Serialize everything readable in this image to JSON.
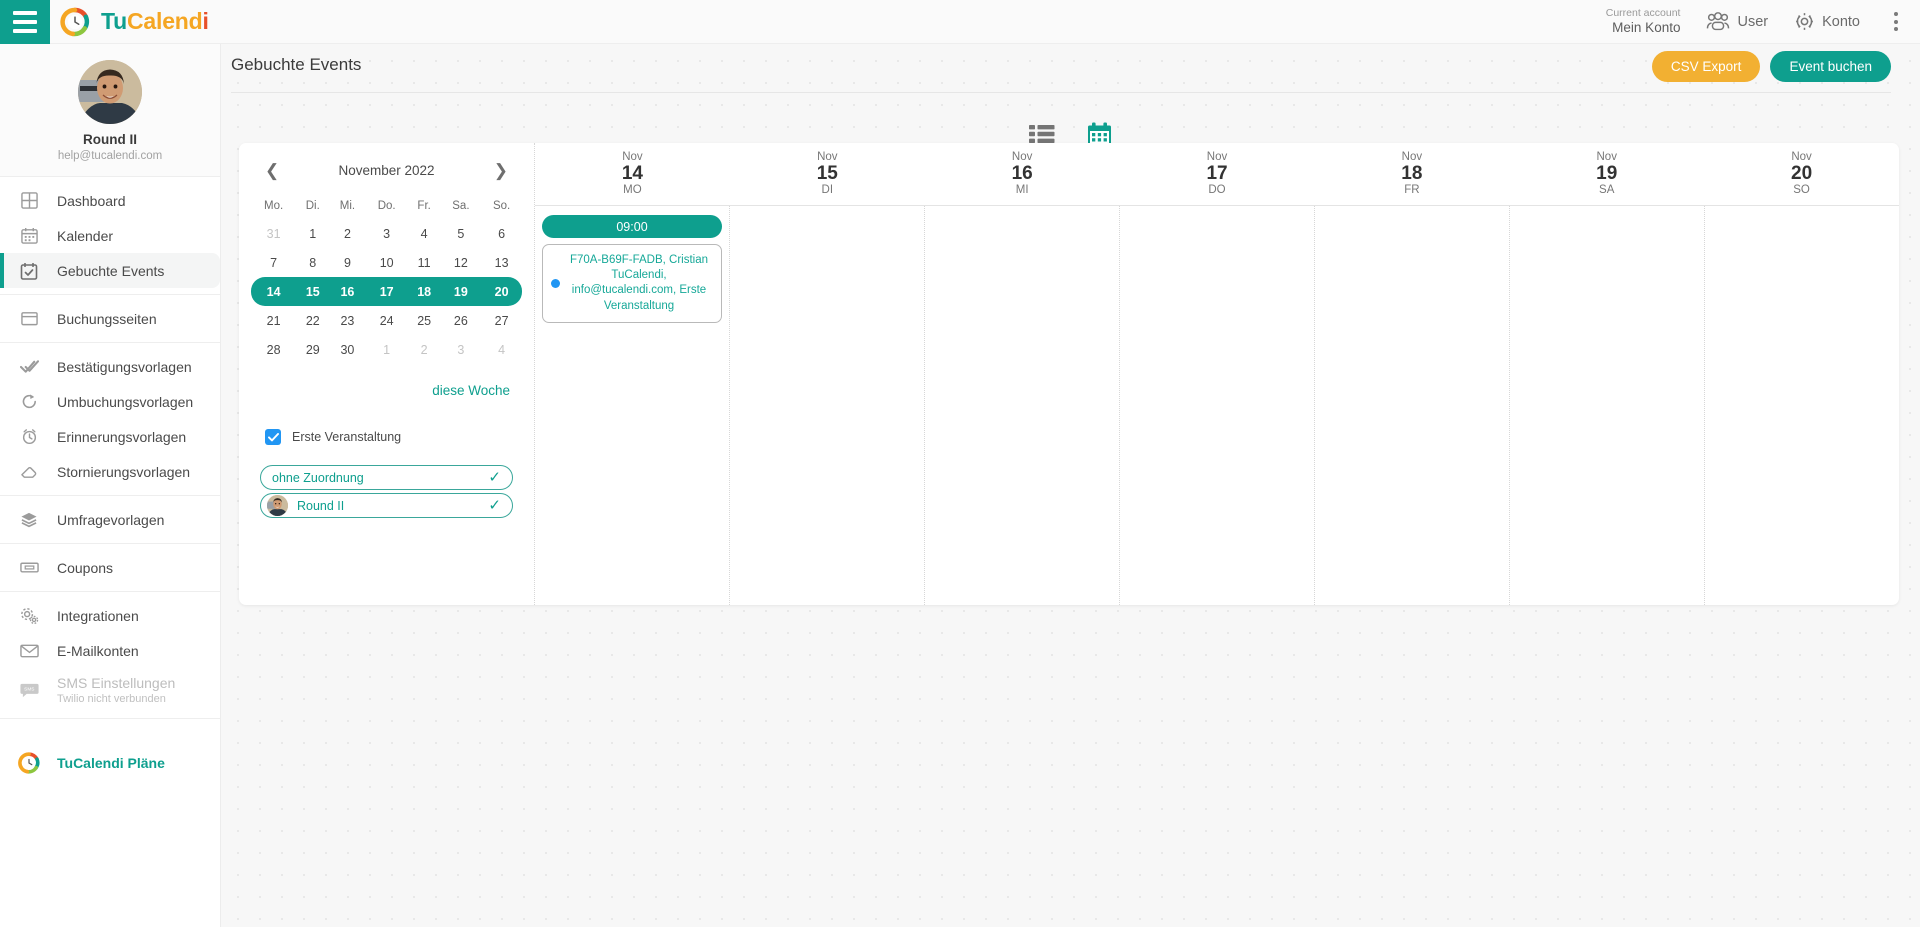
{
  "topbar": {
    "menu_icon": "hamburger-icon",
    "brand": {
      "part1": "Tu",
      "part2": "Calend",
      "part3": "i"
    },
    "account_label": "Current account",
    "account_value": "Mein Konto",
    "user_label": "User",
    "settings_label": "Konto",
    "overflow_icon": "kebab-menu-icon"
  },
  "sidebar": {
    "profile": {
      "name": "Round II",
      "email": "help@tucalendi.com"
    },
    "groups": [
      {
        "items": [
          {
            "label": "Dashboard",
            "icon": "dashboard-grid-icon",
            "active": false
          },
          {
            "label": "Kalender",
            "icon": "calendar-icon",
            "active": false
          },
          {
            "label": "Gebuchte Events",
            "icon": "calendar-check-icon",
            "active": true
          }
        ]
      },
      {
        "items": [
          {
            "label": "Buchungsseiten",
            "icon": "window-icon",
            "active": false
          }
        ]
      },
      {
        "items": [
          {
            "label": "Bestätigungsvorlagen",
            "icon": "double-check-icon",
            "active": false
          },
          {
            "label": "Umbuchungsvorlagen",
            "icon": "refresh-icon",
            "active": false
          },
          {
            "label": "Erinnerungsvorlagen",
            "icon": "alarm-clock-icon",
            "active": false
          },
          {
            "label": "Stornierungsvorlagen",
            "icon": "eraser-icon",
            "active": false
          }
        ]
      },
      {
        "items": [
          {
            "label": "Umfragevorlagen",
            "icon": "layers-icon",
            "active": false
          }
        ]
      },
      {
        "items": [
          {
            "label": "Coupons",
            "icon": "ticket-icon",
            "active": false
          }
        ]
      },
      {
        "items": [
          {
            "label": "Integrationen",
            "icon": "gears-icon",
            "active": false
          },
          {
            "label": "E-Mailkonten",
            "icon": "envelope-icon",
            "active": false
          },
          {
            "label": "SMS Einstellungen",
            "sublabel": "Twilio nicht verbunden",
            "icon": "sms-bubble-icon",
            "active": false,
            "disabled": true
          }
        ]
      },
      {
        "items": [
          {
            "label": "TuCalendi Pläne",
            "icon": "tucalendi-logo-icon",
            "active": false,
            "plan": true
          }
        ]
      }
    ]
  },
  "page": {
    "title": "Gebuchte Events",
    "csv_export_label": "CSV Export",
    "book_event_label": "Event buchen",
    "views": [
      {
        "name": "list-view-icon",
        "active": false
      },
      {
        "name": "calendar-view-icon",
        "active": true
      }
    ]
  },
  "minicalendar": {
    "prev_icon": "chevron-left-icon",
    "next_icon": "chevron-right-icon",
    "month_title": "November 2022",
    "weekday_headers": [
      "Mo.",
      "Di.",
      "Mi.",
      "Do.",
      "Fr.",
      "Sa.",
      "So."
    ],
    "weeks": [
      [
        {
          "d": "31",
          "muted": true
        },
        {
          "d": "1"
        },
        {
          "d": "2"
        },
        {
          "d": "3"
        },
        {
          "d": "4"
        },
        {
          "d": "5"
        },
        {
          "d": "6"
        }
      ],
      [
        {
          "d": "7"
        },
        {
          "d": "8"
        },
        {
          "d": "9"
        },
        {
          "d": "10"
        },
        {
          "d": "11"
        },
        {
          "d": "12"
        },
        {
          "d": "13"
        }
      ],
      [
        {
          "d": "14"
        },
        {
          "d": "15"
        },
        {
          "d": "16"
        },
        {
          "d": "17"
        },
        {
          "d": "18"
        },
        {
          "d": "19"
        },
        {
          "d": "20"
        }
      ],
      [
        {
          "d": "21"
        },
        {
          "d": "22"
        },
        {
          "d": "23"
        },
        {
          "d": "24"
        },
        {
          "d": "25"
        },
        {
          "d": "26"
        },
        {
          "d": "27"
        }
      ],
      [
        {
          "d": "28"
        },
        {
          "d": "29"
        },
        {
          "d": "30"
        },
        {
          "d": "1",
          "muted": true
        },
        {
          "d": "2",
          "muted": true
        },
        {
          "d": "3",
          "muted": true
        },
        {
          "d": "4",
          "muted": true
        }
      ]
    ],
    "selected_week_index": 2,
    "this_week_label": "diese Woche"
  },
  "filters": {
    "checkbox": {
      "label": "Erste Veranstaltung",
      "checked": true
    },
    "pills": [
      {
        "label": "ohne Zuordnung",
        "checked": true,
        "has_avatar": false
      },
      {
        "label": "Round II",
        "checked": true,
        "has_avatar": true
      }
    ]
  },
  "weekview": {
    "days": [
      {
        "month": "Nov",
        "day": "14",
        "dow": "MO"
      },
      {
        "month": "Nov",
        "day": "15",
        "dow": "DI"
      },
      {
        "month": "Nov",
        "day": "16",
        "dow": "MI"
      },
      {
        "month": "Nov",
        "day": "17",
        "dow": "DO"
      },
      {
        "month": "Nov",
        "day": "18",
        "dow": "FR"
      },
      {
        "month": "Nov",
        "day": "19",
        "dow": "SA"
      },
      {
        "month": "Nov",
        "day": "20",
        "dow": "SO"
      }
    ],
    "monday": {
      "time_slot": "09:00",
      "event_text": "F70A-B69F-FADB, Cristian TuCalendi, info@tucalendi.com, Erste Veranstaltung"
    }
  },
  "colors": {
    "brand_teal": "#0E9F8E",
    "brand_orange": "#F5A623",
    "brand_red": "#E8502A",
    "accent_blue": "#2196F3",
    "csv_button": "#F2B032"
  }
}
